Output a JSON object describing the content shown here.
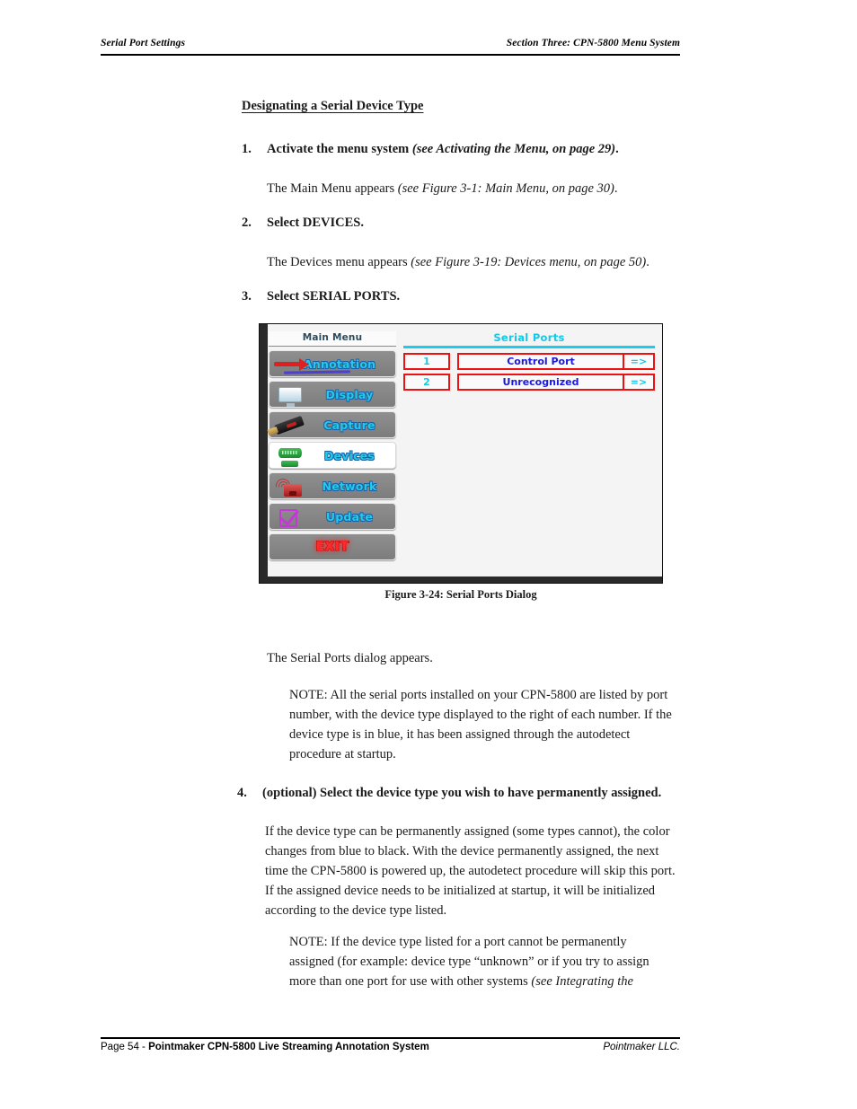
{
  "header": {
    "left": "Serial Port Settings",
    "right": "Section Three: CPN-5800 Menu System"
  },
  "section": {
    "title": "Designating a Serial Device Type"
  },
  "steps": [
    {
      "num": "1.",
      "bold_lead": "Activate the menu system ",
      "italic": "(see Activating the Menu, on page 29)",
      "tail": "."
    },
    {
      "num": "2.",
      "bold_lead": "Select DEVICES.",
      "italic": "",
      "tail": ""
    },
    {
      "num": "3.",
      "bold_lead": "Select SERIAL PORTS.",
      "italic": "",
      "tail": ""
    },
    {
      "num": "4.",
      "bold_lead": "(optional) Select the device type you wish to have permanently assigned.",
      "italic": "",
      "tail": ""
    }
  ],
  "paragraphs": {
    "after_step1": {
      "plain": "The Main Menu appears ",
      "italic": "(see Figure 3-1: Main Menu, on page 30)",
      "tail": "."
    },
    "after_step2": {
      "plain": "The Devices menu appears ",
      "italic": "(see Figure 3-19: Devices menu, on page 50)",
      "tail": "."
    },
    "after_figure": "The Serial Ports dialog appears.",
    "note1": "NOTE: All the serial ports installed on your CPN-5800 are listed by port number, with the device type displayed to the right of each number. If the device type is in blue, it has been assigned through the autodetect procedure at startup.",
    "after_step4": "If the device type can be permanently assigned (some types cannot), the color changes from blue to black. With the device permanently assigned, the next time the CPN-5800 is powered up, the autodetect procedure will skip this port. If the assigned device needs to be initialized at startup, it will be initialized according to the device type listed.",
    "note2_plain": "NOTE: If the device type listed for a port cannot be permanently assigned (for example: device type “unknown” or if you try to assign more than one port for use with other systems ",
    "note2_italic": "(see Integrating the"
  },
  "figure": {
    "caption": "Figure 3-24:  Serial Ports Dialog",
    "menu": {
      "title": "Main Menu",
      "items": [
        {
          "label": "Annotation",
          "icon": "red-arrow-icon",
          "selected": false
        },
        {
          "label": "Display",
          "icon": "monitor-icon",
          "selected": false
        },
        {
          "label": "Capture",
          "icon": "usb-drive-icon",
          "selected": false
        },
        {
          "label": "Devices",
          "icon": "serial-connector-icon",
          "selected": true
        },
        {
          "label": "Network",
          "icon": "network-jack-icon",
          "selected": false
        },
        {
          "label": "Update",
          "icon": "checkbox-check-icon",
          "selected": false
        },
        {
          "label": "EXIT",
          "icon": "",
          "selected": false
        }
      ]
    },
    "ports": {
      "title": "Serial Ports",
      "arrow_glyph": "=>",
      "rows": [
        {
          "number": "1",
          "type": "Control Port"
        },
        {
          "number": "2",
          "type": "Unrecognized"
        }
      ]
    },
    "colors": {
      "accent_cyan": "#16c8e8",
      "border_red": "#ee1111",
      "device_blue": "#1a18e0",
      "menu_gray": "#858585"
    }
  },
  "footer": {
    "page_prefix": "Page 54 - ",
    "product": "Pointmaker CPN-5800 Live Streaming Annotation System",
    "right": "Pointmaker LLC."
  }
}
